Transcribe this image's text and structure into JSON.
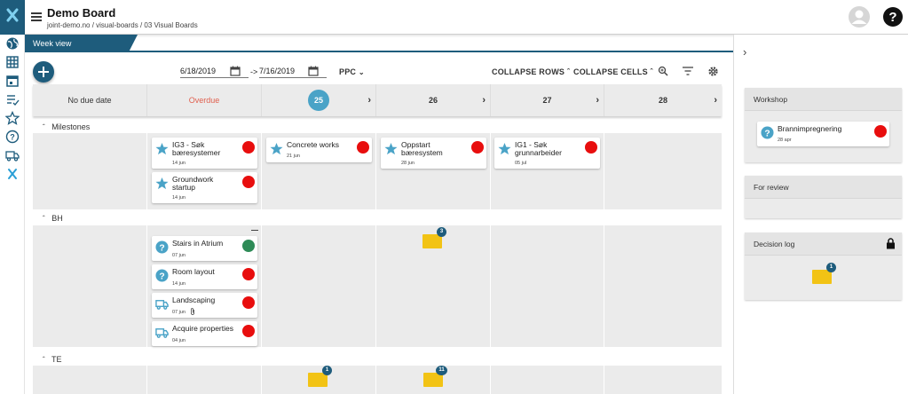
{
  "header": {
    "title": "Demo Board",
    "breadcrumb": "joint-demo.no / visual-boards / 03 Visual Boards"
  },
  "tab": {
    "label": "Week view"
  },
  "toolbar": {
    "date_from": "6/18/2019",
    "arrow": "->",
    "date_to": "7/16/2019",
    "ppc_label": "PPC",
    "collapse_rows": "COLLAPSE ROWS",
    "collapse_cells": "COLLAPSE CELLS"
  },
  "columns": {
    "no_due": "No due date",
    "overdue": "Overdue",
    "w25": "25",
    "w26": "26",
    "w27": "27",
    "w28": "28"
  },
  "rows": {
    "milestones": "Milestones",
    "bh": "BH",
    "te": "TE"
  },
  "cards": [
    {
      "title": "IG3 - Søk bæresystemer",
      "date": "14 jun"
    },
    {
      "title": "Groundwork startup",
      "date": "14 jun"
    },
    {
      "title": "Concrete works",
      "date": "21 jun"
    },
    {
      "title": "Oppstart bæresystem",
      "date": "28 jun"
    },
    {
      "title": "IG1 - Søk grunnarbeider",
      "date": "05 jul"
    },
    {
      "title": "Stairs in Atrium",
      "date": "07 jun"
    },
    {
      "title": "Room layout",
      "date": "14 jun"
    },
    {
      "title": "Landscaping",
      "date": "07 jun"
    },
    {
      "title": "Acquire properties",
      "date": "04 jun"
    }
  ],
  "stacks": {
    "bh_26": "3",
    "te_25": "1",
    "te_26": "11",
    "decision": "1"
  },
  "right_panel": {
    "workshop_title": "Workshop",
    "workshop_card": {
      "title": "Brannimpregnering",
      "date": "28 apr"
    },
    "review_title": "For review",
    "decision_title": "Decision log"
  },
  "colors": {
    "accent": "#1e5c7c",
    "red": "#e80e0e",
    "green": "#2e8b57",
    "star": "#4aa3c7",
    "overdue": "#e0604f",
    "note": "#f2c315"
  }
}
